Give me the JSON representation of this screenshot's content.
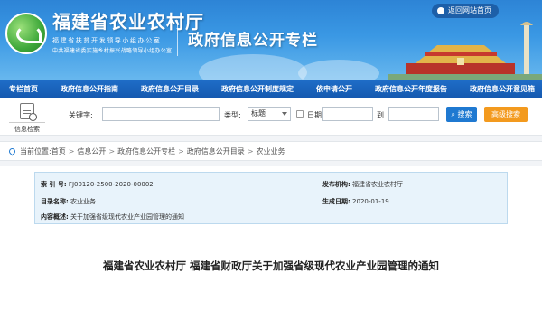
{
  "header": {
    "site_title": "福建省农业农村厅",
    "sub_line1": "福建省扶贫开发领导小组办公室",
    "sub_line2": "中共福建省委实施乡村振兴战略领导小组办公室",
    "column_title": "政府信息公开专栏",
    "back_home_label": "返回网站首页"
  },
  "nav": {
    "items": [
      "专栏首页",
      "政府信息公开指南",
      "政府信息公开目录",
      "政府信息公开制度规定",
      "依申请公开",
      "政府信息公开年度报告",
      "政府信息公开意见箱"
    ]
  },
  "search": {
    "info_search_label": "信息检索",
    "keyword_label": "关键字:",
    "keyword_value": "",
    "type_label": "类型:",
    "type_value": "标题",
    "date_label": "日期:",
    "date_from": "",
    "to_label": "到",
    "date_to": "",
    "search_button": "搜索",
    "advanced_button": "高级搜索"
  },
  "breadcrumb": {
    "prefix": "当前位置:",
    "items": [
      "首页",
      "信息公开",
      "政府信息公开专栏",
      "政府信息公开目录",
      "农业业务"
    ]
  },
  "meta": {
    "index_label": "索 引 号:",
    "index_value": "FJ00120-2500-2020-00002",
    "publisher_label": "发布机构:",
    "publisher_value": "福建省农业农村厅",
    "category_label": "目录名称:",
    "category_value": "农业业务",
    "date_label": "生成日期:",
    "date_value": "2020-01-19",
    "summary_label": "内容概述:",
    "summary_value": "关于加强省级现代农业产业园管理的通知"
  },
  "article": {
    "title": "福建省农业农村厅 福建省财政厅关于加强省级现代农业产业园管理的通知"
  }
}
